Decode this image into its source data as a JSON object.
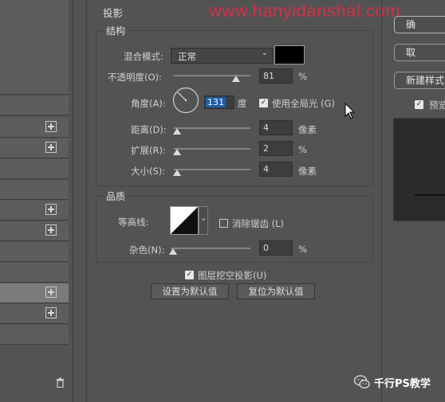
{
  "watermark": "www.hanyidanshal.com",
  "panel": {
    "title": "投影",
    "structure": {
      "title": "结构",
      "blend_mode_label": "混合模式:",
      "blend_mode_value": "正常",
      "opacity_label": "不透明度(O):",
      "opacity_value": "81",
      "opacity_unit": "%",
      "angle_label": "角度(A):",
      "angle_value": "131",
      "angle_unit": "度",
      "global_light_label": "使用全局光 (G)",
      "distance_label": "距离(D):",
      "distance_value": "4",
      "distance_unit": "像素",
      "spread_label": "扩展(R):",
      "spread_value": "2",
      "spread_unit": "%",
      "size_label": "大小(S):",
      "size_value": "4",
      "size_unit": "像素"
    },
    "quality": {
      "title": "品质",
      "contour_label": "等高线:",
      "antialias_label": "消除锯齿 (L)",
      "noise_label": "杂色(N):",
      "noise_value": "0",
      "noise_unit": "%"
    },
    "knockout_label": "图层挖空投影(U)",
    "make_default_label": "设置为默认值",
    "reset_default_label": "复位为默认值"
  },
  "right": {
    "ok_label": "确",
    "cancel_label": "取",
    "new_style_label": "新建样式",
    "preview_label": "预览"
  },
  "footer": {
    "brand": "千行PS教学"
  },
  "colors": {
    "accent_selected": "#1f5fa8",
    "shadow_color": "#000000"
  }
}
